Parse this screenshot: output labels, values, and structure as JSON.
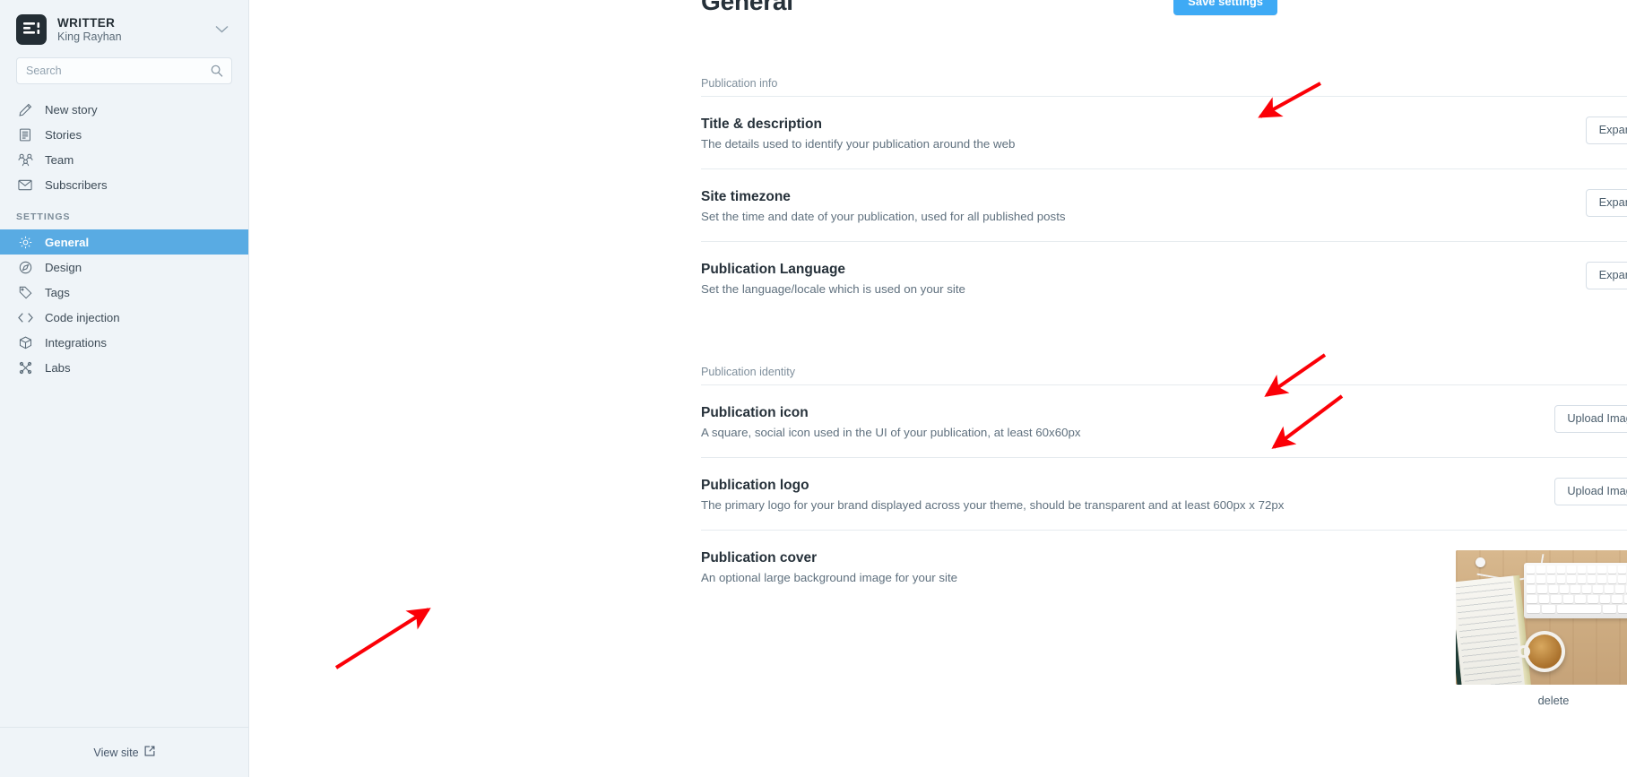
{
  "sidebar": {
    "brand": {
      "title": "WRITTER",
      "subtitle": "King Rayhan"
    },
    "search": {
      "placeholder": "Search",
      "value": ""
    },
    "nav_primary": [
      {
        "label": "New story",
        "icon": "pencil-icon"
      },
      {
        "label": "Stories",
        "icon": "document-icon"
      },
      {
        "label": "Team",
        "icon": "team-icon"
      },
      {
        "label": "Subscribers",
        "icon": "envelope-icon"
      }
    ],
    "section_label": "SETTINGS",
    "nav_settings": [
      {
        "label": "General",
        "icon": "gear-icon",
        "active": true
      },
      {
        "label": "Design",
        "icon": "compass-icon",
        "active": false
      },
      {
        "label": "Tags",
        "icon": "tag-icon",
        "active": false
      },
      {
        "label": "Code injection",
        "icon": "code-icon",
        "active": false
      },
      {
        "label": "Integrations",
        "icon": "box-icon",
        "active": false
      },
      {
        "label": "Labs",
        "icon": "labs-icon",
        "active": false
      }
    ],
    "footer": {
      "label": "View site",
      "icon": "external-link-icon"
    }
  },
  "header": {
    "title": "General",
    "save_label": "Save settings"
  },
  "sections": [
    {
      "label": "Publication info",
      "rows": [
        {
          "title": "Title & description",
          "description": "The details used to identify your publication around the web",
          "action": "Expand"
        },
        {
          "title": "Site timezone",
          "description": "Set the time and date of your publication, used for all published posts",
          "action": "Expand"
        },
        {
          "title": "Publication Language",
          "description": "Set the language/locale which is used on your site",
          "action": "Expand"
        }
      ]
    },
    {
      "label": "Publication identity",
      "rows": [
        {
          "title": "Publication icon",
          "description": "A square, social icon used in the UI of your publication, at least 60x60px",
          "action": "Upload Image"
        },
        {
          "title": "Publication logo",
          "description": "The primary logo for your brand displayed across your theme, should be transparent and at least 600px x 72px",
          "action": "Upload Image"
        },
        {
          "title": "Publication cover",
          "description": "An optional large background image for your site",
          "action": "delete"
        }
      ]
    }
  ],
  "colors": {
    "accent": "#3eaaf5",
    "sidebar_bg": "#eff4f8",
    "active_nav": "#59abe3",
    "annotation": "#fb0007",
    "text_primary": "#26313a",
    "text_muted": "#5f707e"
  }
}
